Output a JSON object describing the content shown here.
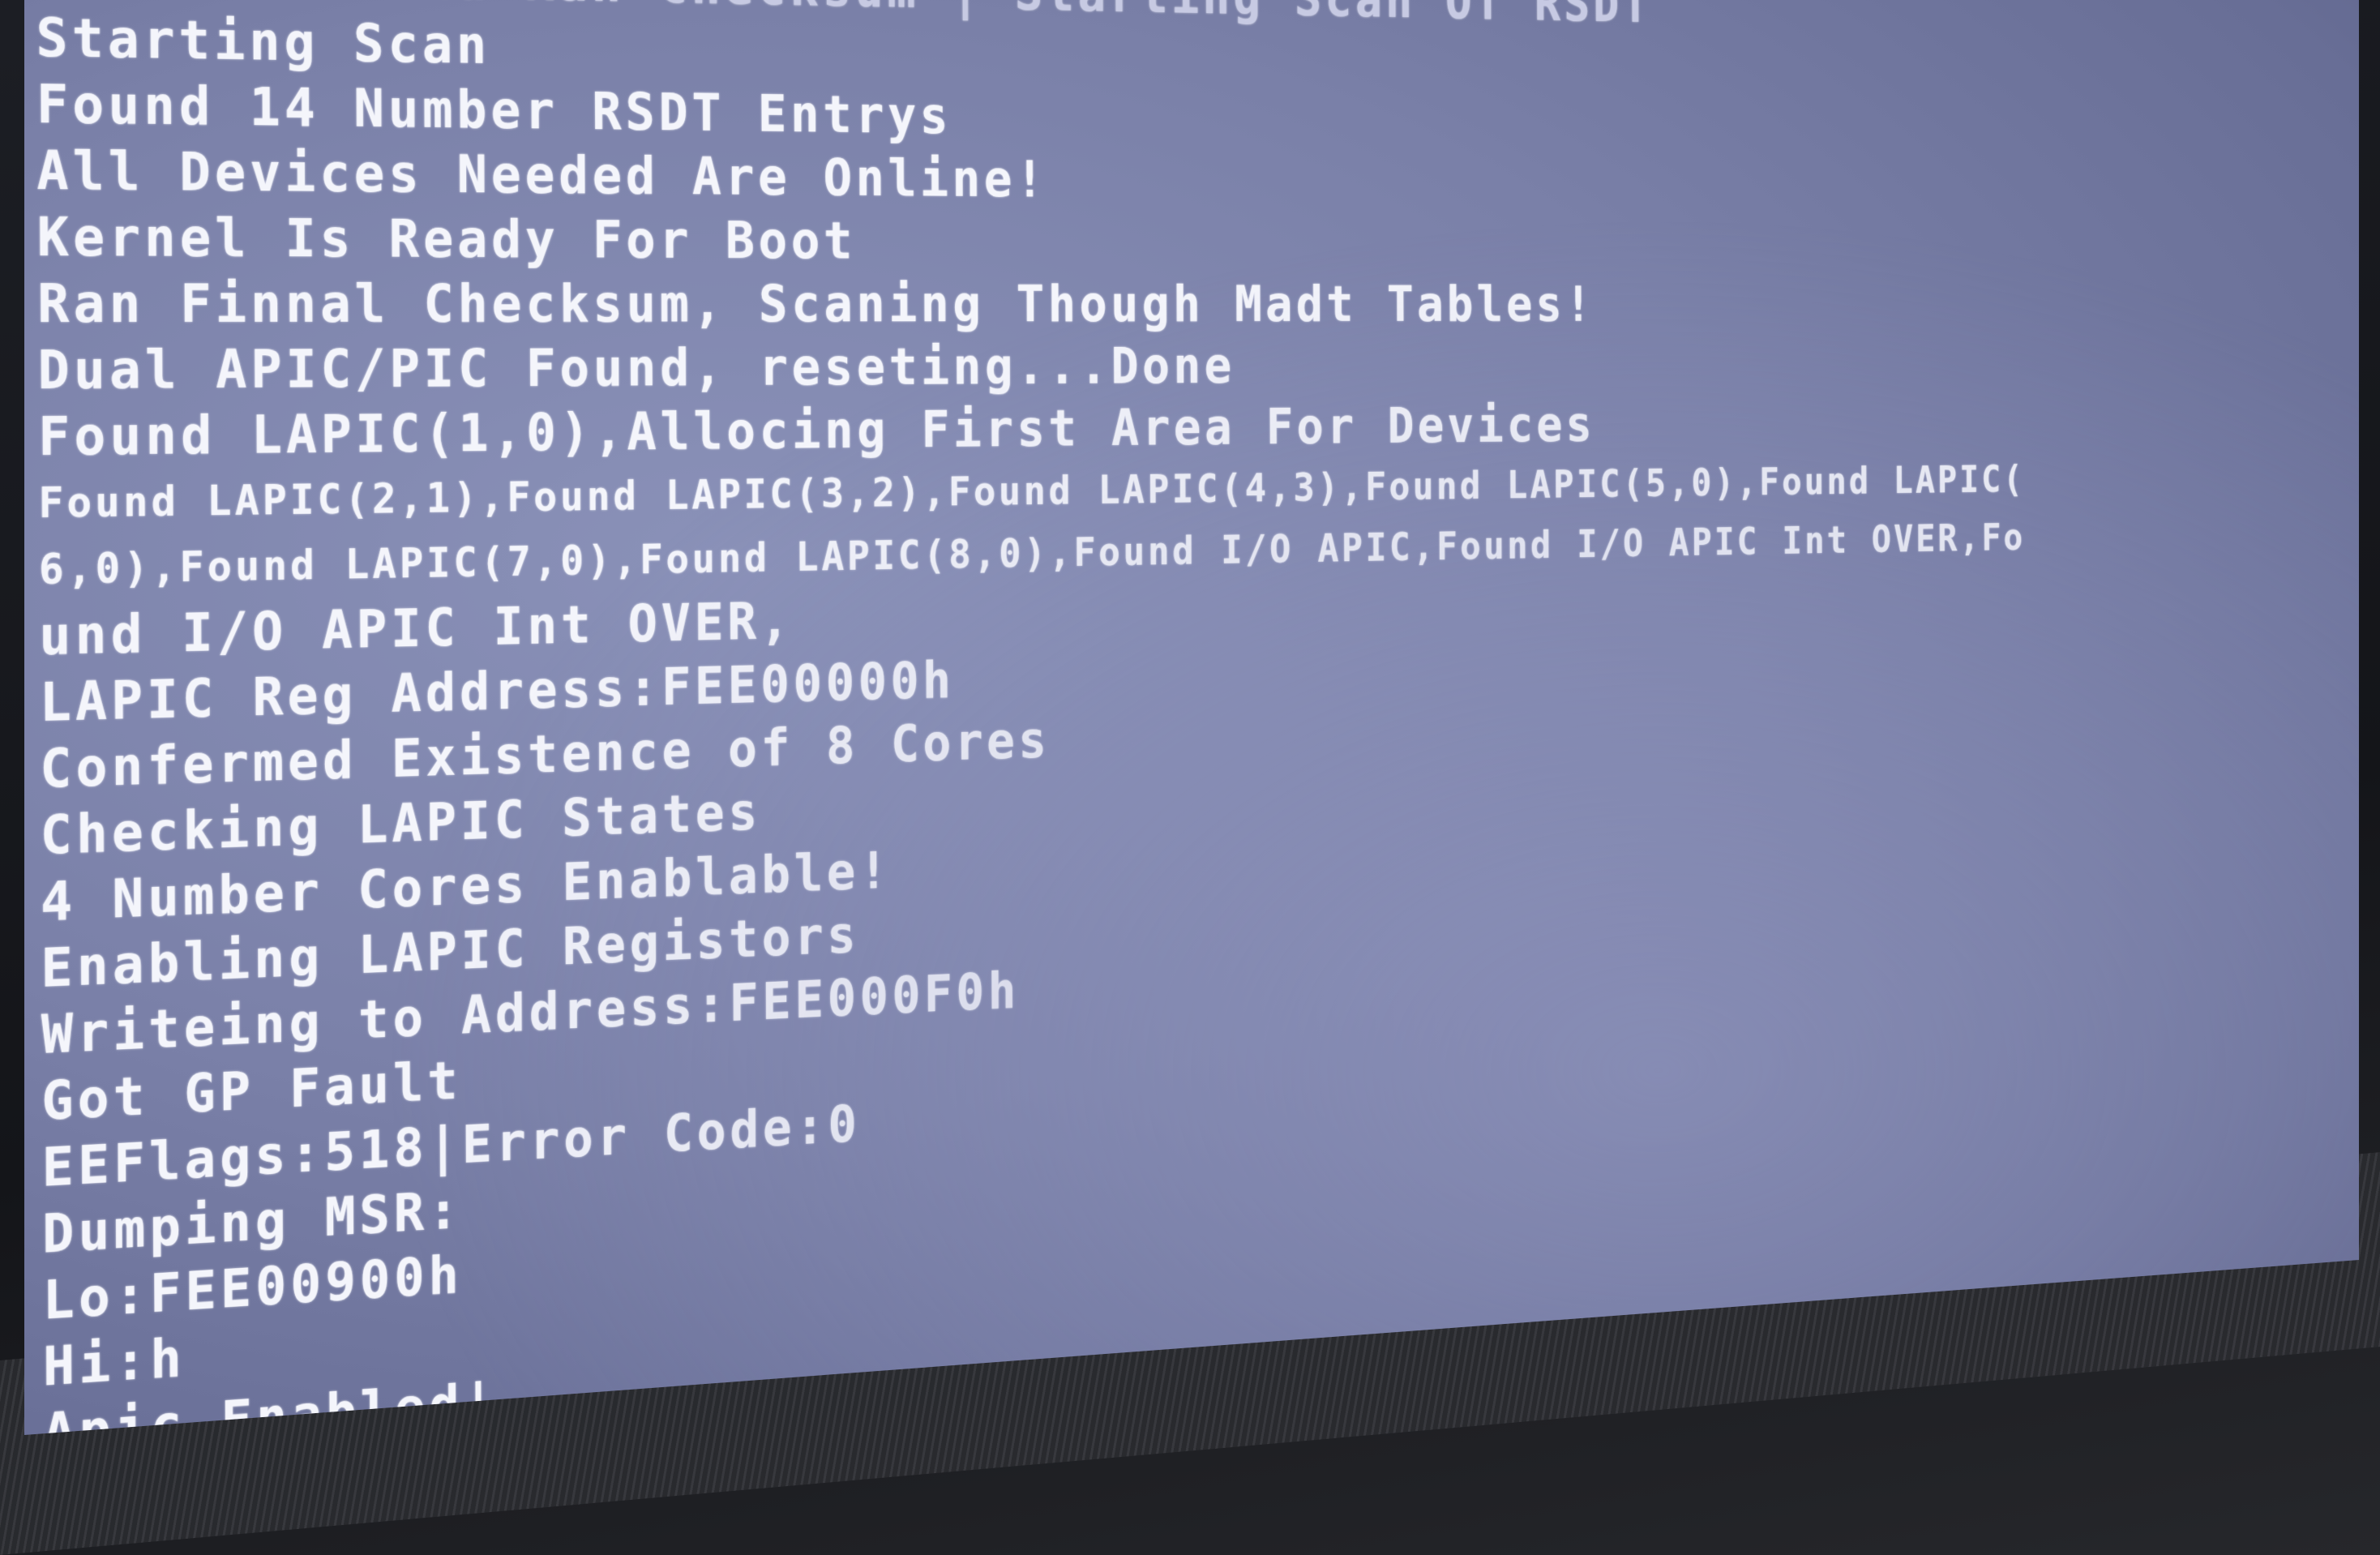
{
  "screen": {
    "lines": [
      "  Address and Ran Checksum | Starting Scan Of RSDT",
      "Starting Scan",
      "Found 14 Number RSDT Entrys",
      "All Devices Needed Are Online!",
      "Kernel Is Ready For Boot",
      "Ran Finnal Checksum, Scaning Though Madt Tables!",
      "Dual APIC/PIC Found, reseting...Done",
      "Found LAPIC(1,0),Allocing First Area For Devices",
      "Found LAPIC(2,1),Found LAPIC(3,2),Found LAPIC(4,3),Found LAPIC(5,0),Found LAPIC(",
      "6,0),Found LAPIC(7,0),Found LAPIC(8,0),Found I/O APIC,Found I/O APIC Int OVER,Fo",
      "und I/O APIC Int OVER,",
      "LAPIC Reg Address:FEE00000h",
      "Confermed Existence of 8 Cores",
      "Checking LAPIC States",
      "4 Number Cores Enablable!",
      "Enabling LAPIC Registors",
      "Writeing to Address:FEE000F0h",
      "Got GP Fault",
      "EEFlags:518|Error Code:0",
      "Dumping MSR:",
      "Lo:FEE00900h",
      "Hi:h",
      "Apic Enabled|"
    ]
  }
}
